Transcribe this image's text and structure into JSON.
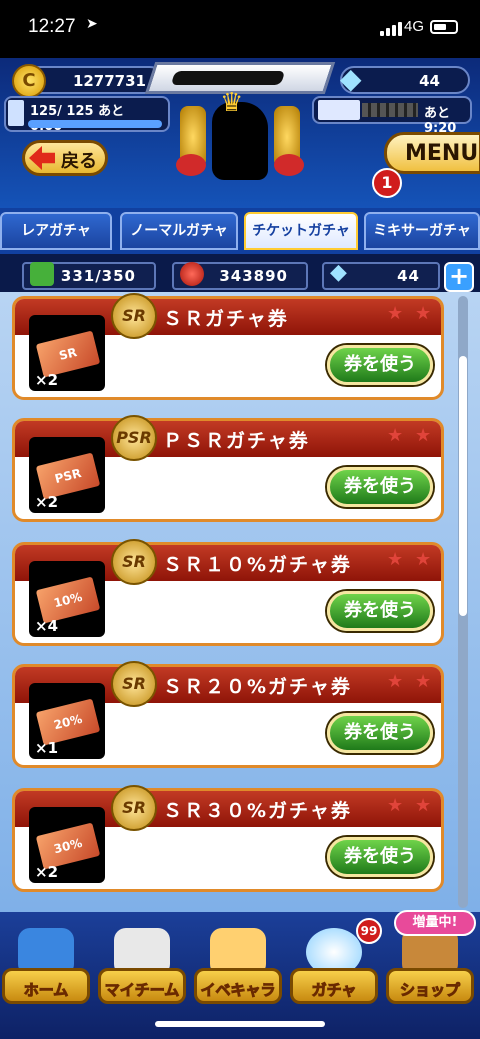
{
  "status_bar": {
    "time": "12:27",
    "location_icon": "location-arrow",
    "network": "4G"
  },
  "header": {
    "coins": "1277731",
    "coin_icon_label": "C",
    "gems": "44",
    "stamina": "125/ 125 あと　0:00",
    "ticket_timer": "あと　9:20"
  },
  "nav_buttons": {
    "back": "戻る",
    "menu": "MENU",
    "menu_badge": "1"
  },
  "tabs": [
    "レアガチャ",
    "ノーマルガチャ",
    "チケットガチャ",
    "ミキサーガチャ"
  ],
  "active_tab": 2,
  "resources": {
    "box": "331/350",
    "balls": "343890",
    "gems": "44"
  },
  "tickets": [
    {
      "name": "ＳＲガチャ券",
      "emblem": "SR",
      "ticket_label": "SR",
      "qty": "×2",
      "button": "券を使う"
    },
    {
      "name": "ＰＳＲガチャ券",
      "emblem": "PSR",
      "ticket_label": "PSR",
      "qty": "×2",
      "button": "券を使う"
    },
    {
      "name": "ＳＲ１０%ガチャ券",
      "emblem": "SR",
      "ticket_label": "10%",
      "qty": "×4",
      "button": "券を使う"
    },
    {
      "name": "ＳＲ２０%ガチャ券",
      "emblem": "SR",
      "ticket_label": "20%",
      "qty": "×1",
      "button": "券を使う"
    },
    {
      "name": "ＳＲ３０%ガチャ券",
      "emblem": "SR",
      "ticket_label": "30%",
      "qty": "×2",
      "button": "券を使う"
    }
  ],
  "bottom_nav": [
    {
      "label": "ホーム",
      "icon": "home-book-icon"
    },
    {
      "label": "マイチーム",
      "icon": "team-icon"
    },
    {
      "label": "イベキャラ",
      "icon": "event-chara-icon"
    },
    {
      "label": "ガチャ",
      "icon": "gacha-icon",
      "badge": "99"
    },
    {
      "label": "ショップ",
      "icon": "shop-icon",
      "banner": "増量中!"
    }
  ],
  "colors": {
    "card_header": "#b02a18",
    "use_button": "#2e9a24",
    "accent_gold": "#f0c040"
  }
}
